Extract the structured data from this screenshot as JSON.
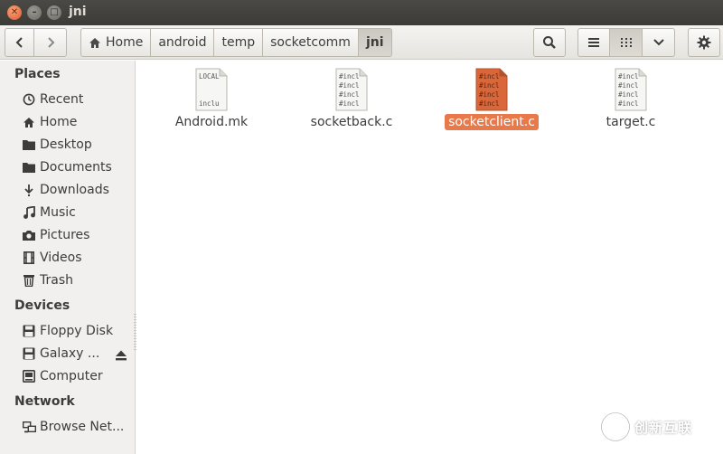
{
  "window": {
    "title": "jni"
  },
  "toolbar": {
    "breadcrumbs": [
      {
        "label": "Home"
      },
      {
        "label": "android"
      },
      {
        "label": "temp"
      },
      {
        "label": "socketcomm"
      },
      {
        "label": "jni",
        "active": true
      }
    ]
  },
  "sidebar": {
    "places_heading": "Places",
    "places": [
      {
        "label": "Recent",
        "icon": "clock-icon"
      },
      {
        "label": "Home",
        "icon": "home-icon"
      },
      {
        "label": "Desktop",
        "icon": "folder-icon"
      },
      {
        "label": "Documents",
        "icon": "folder-icon"
      },
      {
        "label": "Downloads",
        "icon": "download-icon"
      },
      {
        "label": "Music",
        "icon": "music-icon"
      },
      {
        "label": "Pictures",
        "icon": "camera-icon"
      },
      {
        "label": "Videos",
        "icon": "film-icon"
      },
      {
        "label": "Trash",
        "icon": "trash-icon"
      }
    ],
    "devices_heading": "Devices",
    "devices": [
      {
        "label": "Floppy Disk",
        "icon": "drive-icon"
      },
      {
        "label": "Galaxy ...",
        "icon": "drive-icon",
        "eject": true
      },
      {
        "label": "Computer",
        "icon": "computer-icon"
      }
    ],
    "network_heading": "Network",
    "network": [
      {
        "label": "Browse Net...",
        "icon": "network-icon"
      }
    ]
  },
  "files": [
    {
      "name": "Android.mk",
      "preview": [
        "LOCAL",
        "",
        "",
        "inclu"
      ],
      "selected": false
    },
    {
      "name": "socketback.c",
      "preview": [
        "#incl",
        "#incl",
        "#incl",
        "#incl"
      ],
      "selected": false
    },
    {
      "name": "socketclient.c",
      "preview": [
        "#incl",
        "#incl",
        "#incl",
        "#incl"
      ],
      "selected": true
    },
    {
      "name": "target.c",
      "preview": [
        "#incl",
        "#incl",
        "#incl",
        "#incl"
      ],
      "selected": false
    }
  ],
  "watermark": {
    "text": "创新互联"
  },
  "colors": {
    "selection": "#e7794b",
    "titlebar": "#3c3b37",
    "sidebar_bg": "#f1f0ee"
  }
}
